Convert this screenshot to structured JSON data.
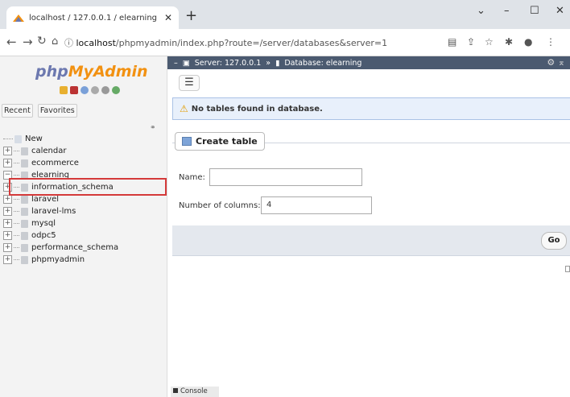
{
  "browser": {
    "tab_title": "localhost / 127.0.0.1 / elearning",
    "new_tab": "+",
    "url_host": "localhost",
    "url_path": "/phpmyadmin/index.php?route=/server/databases&server=1"
  },
  "sidebar": {
    "logo_php": "php",
    "logo_myadmin": "MyAdmin",
    "recent_label": "Recent",
    "favorites_label": "Favorites",
    "items": [
      {
        "label": "New"
      },
      {
        "label": "calendar"
      },
      {
        "label": "ecommerce"
      },
      {
        "label": "elearning"
      },
      {
        "label": "information_schema"
      },
      {
        "label": "laravel"
      },
      {
        "label": "laravel-lms"
      },
      {
        "label": "mysql"
      },
      {
        "label": "odpc5"
      },
      {
        "label": "performance_schema"
      },
      {
        "label": "phpmyadmin"
      }
    ]
  },
  "breadcrumb": {
    "server": "Server: 127.0.0.1",
    "separator": "»",
    "database": "Database: elearning"
  },
  "notice": "No tables found in database.",
  "create_table": {
    "legend": "Create table",
    "name_label": "Name:",
    "name_value": "",
    "columns_label": "Number of columns:",
    "columns_value": "4",
    "go_label": "Go"
  },
  "console_label": "Console",
  "colors": {
    "breadcrumb_bg": "#4b5a70",
    "selection_border": "#d43a3a",
    "logo_php": "#6c78af",
    "logo_myadmin": "#f29111"
  }
}
